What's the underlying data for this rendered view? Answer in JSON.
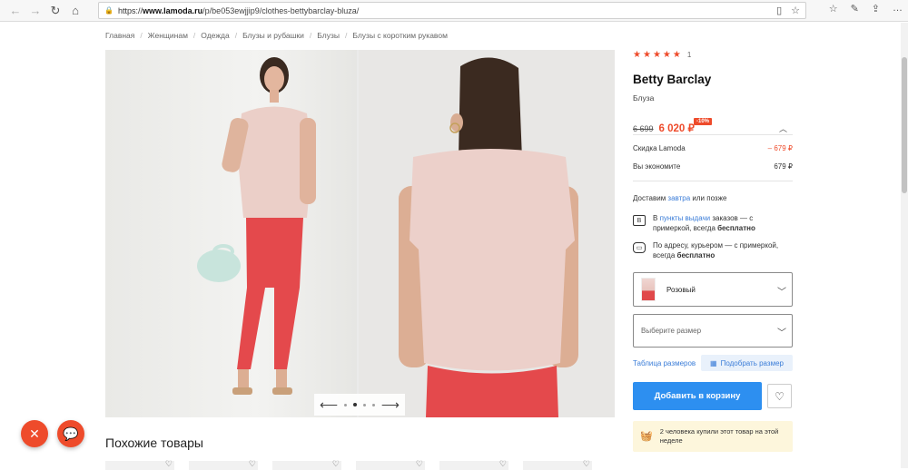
{
  "browser": {
    "url_scheme": "https://",
    "url_domain": "www.lamoda.ru",
    "url_path": "/p/be053ewjjip9/clothes-bettybarclay-bluza/"
  },
  "breadcrumb": [
    "Главная",
    "Женщинам",
    "Одежда",
    "Блузы и рубашки",
    "Блузы",
    "Блузы с коротким рукавом"
  ],
  "rating": {
    "stars": 5,
    "count": "1"
  },
  "product": {
    "brand": "Betty Barclay",
    "type": "Блуза",
    "old_price": "6 699",
    "new_price": "6 020 ₽",
    "discount_badge": "-10%"
  },
  "price_lines": {
    "discount_label": "Скидка Lamoda",
    "discount_value": "– 679 ₽",
    "save_label": "Вы экономите",
    "save_value": "679 ₽"
  },
  "delivery": {
    "head_prefix": "Доставим ",
    "head_link": "завтра",
    "head_suffix": " или позже",
    "pickup_prefix": "В ",
    "pickup_link": "пункты выдачи",
    "pickup_mid": " заказов — с примеркой, всегда ",
    "pickup_bold": "бесплатно",
    "courier_text": "По адресу, курьером — с примеркой, всегда ",
    "courier_bold": "бесплатно"
  },
  "options": {
    "color": "Розовый",
    "size_placeholder": "Выберите размер",
    "size_table": "Таблица размеров",
    "fit_size": "Подобрать размер"
  },
  "actions": {
    "add_to_cart": "Добавить в корзину"
  },
  "notice": "2 человека купили этот товар на этой неделе",
  "similar_title": "Похожие товары",
  "icons": {
    "back": "arrow-left-icon",
    "forward": "arrow-right-icon",
    "reload": "reload-icon",
    "home": "home-icon",
    "favorite": "heart-icon",
    "close": "close-icon",
    "chat": "chat-icon"
  },
  "colors": {
    "accent": "#ee4b2b",
    "primary_button": "#2d8ff0",
    "link": "#3b7dd8",
    "notice_bg": "#fdf6dc"
  }
}
